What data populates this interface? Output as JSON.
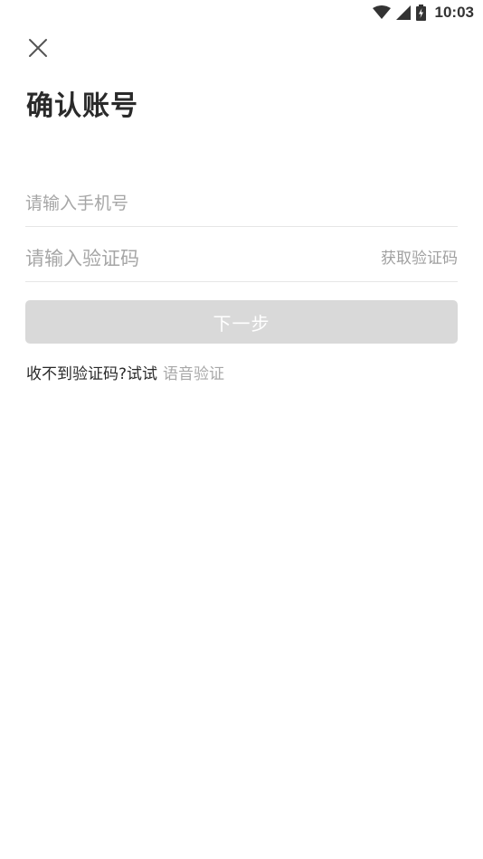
{
  "status_bar": {
    "time": "10:03",
    "icons": [
      "wifi-icon",
      "cellular-signal-icon",
      "battery-charging-icon"
    ]
  },
  "header": {
    "close_icon": "close-icon",
    "title": "确认账号"
  },
  "form": {
    "phone_placeholder": "请输入手机号",
    "phone_value": "",
    "code_placeholder": "请输入验证码",
    "code_value": "",
    "get_code_label": "获取验证码",
    "next_label": "下一步"
  },
  "hint": {
    "text": "收不到验证码?试试",
    "voice_link": "语音验证"
  },
  "colors": {
    "disabled_button": "#d9d9d9",
    "muted_text": "#a6a6a6",
    "divider": "#e6e6e6",
    "title_text": "#2a2a2a"
  }
}
